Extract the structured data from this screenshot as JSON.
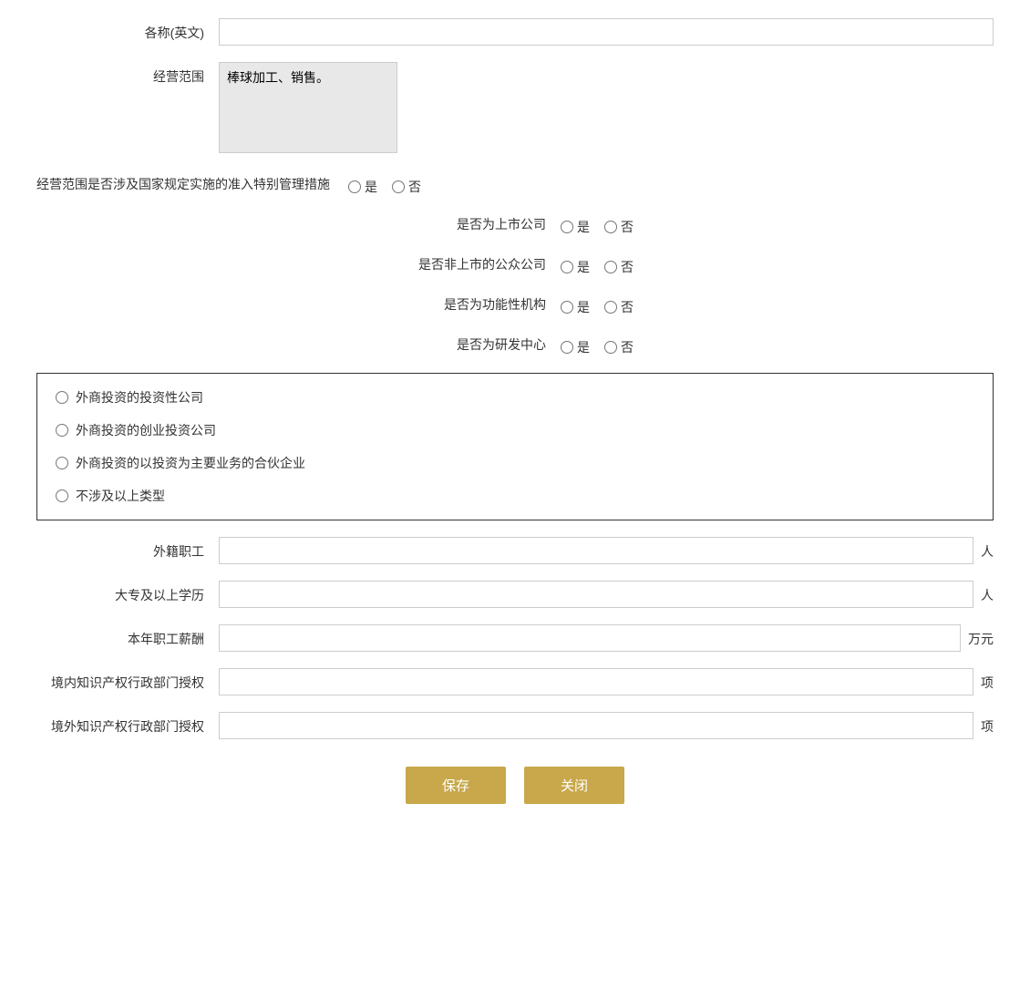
{
  "form": {
    "name_en_label": "各称(英文)",
    "name_en_value": "",
    "business_scope_label": "经营范围",
    "business_scope_value": "棒球加工、销售。",
    "special_mgmt_label": "经营范围是否涉及国家规定实施的准入特别管理措施",
    "special_mgmt_yes": "是",
    "special_mgmt_no": "否",
    "listed_label": "是否为上市公司",
    "listed_yes": "是",
    "listed_no": "否",
    "public_unlisted_label": "是否非上市的公众公司",
    "public_unlisted_yes": "是",
    "public_unlisted_no": "否",
    "functional_org_label": "是否为功能性机构",
    "functional_org_yes": "是",
    "functional_org_no": "否",
    "rd_center_label": "是否为研发中心",
    "rd_center_yes": "是",
    "rd_center_no": "否",
    "invest_type_options": [
      "外商投资的投资性公司",
      "外商投资的创业投资公司",
      "外商投资的以投资为主要业务的合伙企业",
      "不涉及以上类型"
    ],
    "foreign_staff_label": "外籍职工",
    "foreign_staff_unit": "人",
    "foreign_staff_value": "",
    "edu_label": "大专及以上学历",
    "edu_unit": "人",
    "edu_value": "",
    "salary_label": "本年职工薪酬",
    "salary_unit": "万元",
    "salary_value": "",
    "domestic_ip_label": "境内知识产权行政部门授权",
    "domestic_ip_unit": "项",
    "domestic_ip_value": "",
    "foreign_ip_label": "境外知识产权行政部门授权",
    "foreign_ip_unit": "项",
    "foreign_ip_value": "",
    "save_button": "保存",
    "close_button": "关闭"
  }
}
